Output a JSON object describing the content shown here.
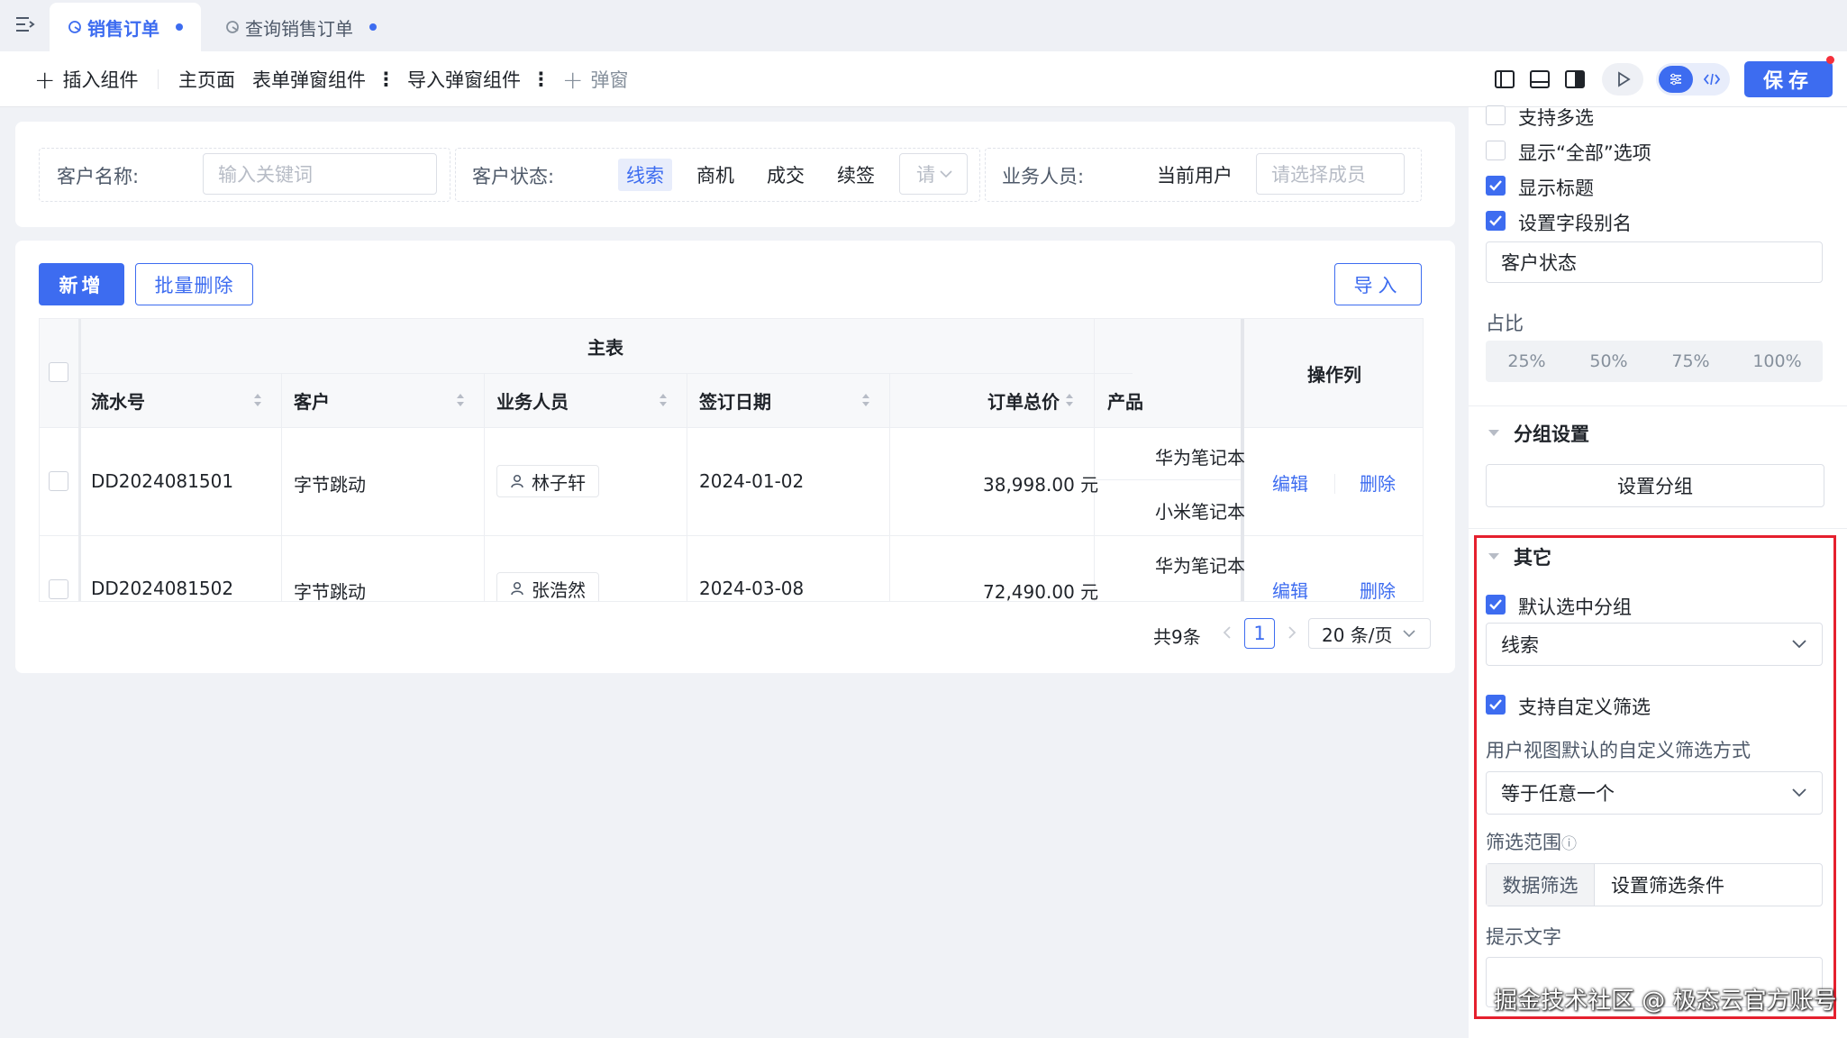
{
  "tabs": [
    {
      "label": "销售订单",
      "active": true
    },
    {
      "label": "查询销售订单",
      "active": false
    }
  ],
  "toolbar": {
    "insert_component": "插入组件",
    "main_page": "主页面",
    "form_popup": "表单弹窗组件",
    "import_popup": "导入弹窗组件",
    "popup": "弹窗",
    "save": "保存"
  },
  "filters": {
    "customer_name_label": "客户名称:",
    "customer_name_placeholder": "输入关键词",
    "customer_status_label": "客户状态:",
    "status_options": [
      "线索",
      "商机",
      "成交",
      "续签"
    ],
    "status_selected": "线索",
    "status_more_placeholder": "请",
    "sales_label": "业务人员:",
    "sales_current": "当前用户",
    "sales_placeholder": "请选择成员"
  },
  "actions": {
    "add": "新增",
    "batch_delete": "批量删除",
    "import": "导入"
  },
  "table": {
    "group_header": "主表",
    "ops_header": "操作列",
    "columns": [
      "流水号",
      "客户",
      "业务人员",
      "签订日期",
      "订单总价",
      "产品"
    ],
    "rows": [
      {
        "serial": "DD2024081501",
        "customer": "字节跳动",
        "sales": "林子轩",
        "date": "2024-01-02",
        "total": "38,998.00 元",
        "products": [
          "华为笔记本",
          "小米笔记本"
        ],
        "edit": "编辑",
        "delete": "删除"
      },
      {
        "serial": "DD2024081502",
        "customer": "字节跳动",
        "sales": "张浩然",
        "date": "2024-03-08",
        "total": "72,490.00 元",
        "products": [
          "华为笔记本"
        ],
        "edit": "编辑",
        "delete": "删除"
      }
    ]
  },
  "pagination": {
    "total": "共9条",
    "current": "1",
    "page_size": "20 条/页"
  },
  "panel": {
    "multi_select": "支持多选",
    "show_all": "显示“全部”选项",
    "show_title": "显示标题",
    "field_alias": "设置字段别名",
    "alias_value": "客户状态",
    "ratio_label": "占比",
    "ratio_options": [
      "25%",
      "50%",
      "75%",
      "100%"
    ],
    "group_section": "分组设置",
    "set_group": "设置分组",
    "other_section": "其它",
    "default_group": "默认选中分组",
    "default_group_value": "线索",
    "custom_filter": "支持自定义筛选",
    "user_default_filter_label": "用户视图默认的自定义筛选方式",
    "filter_method_value": "等于任意一个",
    "filter_range_label": "筛选范围",
    "data_filter": "数据筛选",
    "set_filter_condition": "设置筛选条件",
    "hint_text_label": "提示文字"
  },
  "watermark": "掘金技术社区 @ 极态云官方账号",
  "colors": {
    "accent": "#3d6cf0",
    "highlight": "#e5202e"
  }
}
